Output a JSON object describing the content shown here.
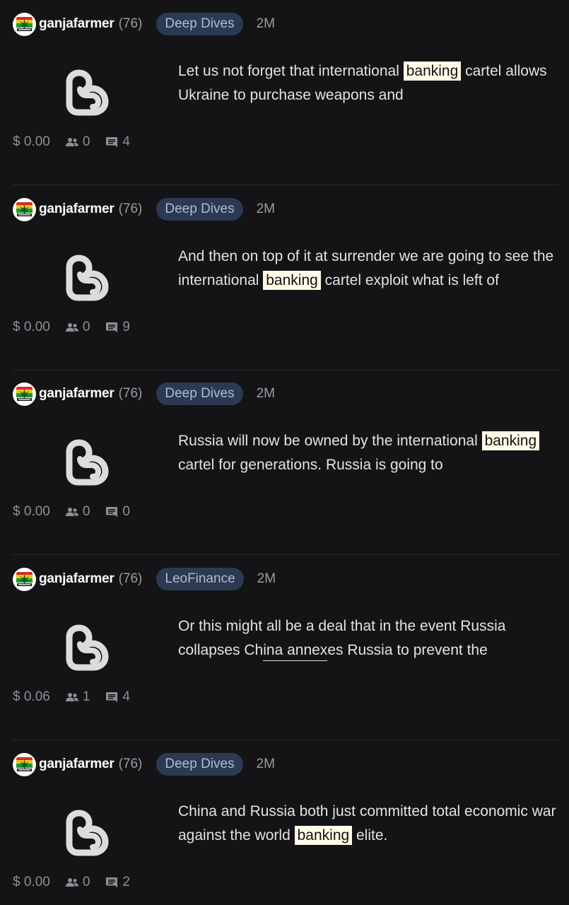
{
  "posts": [
    {
      "author": "ganjafarmer",
      "reputation": "(76)",
      "community": "Deep Dives",
      "time": "2M",
      "body_parts": [
        {
          "text": "Let us not forget that international "
        },
        {
          "text": "banking",
          "style": "hl"
        },
        {
          "text": " cartel allows Ukraine to purchase weapons and"
        }
      ],
      "payout": "$ 0.00",
      "votes": "0",
      "comments": "4"
    },
    {
      "author": "ganjafarmer",
      "reputation": "(76)",
      "community": "Deep Dives",
      "time": "2M",
      "body_parts": [
        {
          "text": "And then on top of it at surrender we are going to see the international "
        },
        {
          "text": "banking",
          "style": "hl"
        },
        {
          "text": " cartel exploit what is left of"
        }
      ],
      "payout": "$ 0.00",
      "votes": "0",
      "comments": "9"
    },
    {
      "author": "ganjafarmer",
      "reputation": "(76)",
      "community": "Deep Dives",
      "time": "2M",
      "body_parts": [
        {
          "text": "Russia will now be owned by the international "
        },
        {
          "text": "banking",
          "style": "hl"
        },
        {
          "text": " cartel for generations. Russia is going to"
        }
      ],
      "payout": "$ 0.00",
      "votes": "0",
      "comments": "0"
    },
    {
      "author": "ganjafarmer",
      "reputation": "(76)",
      "community": "LeoFinance",
      "time": "2M",
      "body_parts": [
        {
          "text": "Or this might all be a deal that in the event Russia collapses Ch"
        },
        {
          "text": "ina annex",
          "style": "ul"
        },
        {
          "text": "es Russia to prevent the"
        }
      ],
      "payout": "$ 0.06",
      "votes": "1",
      "comments": "4"
    },
    {
      "author": "ganjafarmer",
      "reputation": "(76)",
      "community": "Deep Dives",
      "time": "2M",
      "body_parts": [
        {
          "text": "China and Russia both just committed total economic war against the world "
        },
        {
          "text": "banking",
          "style": "hl"
        },
        {
          "text": " elite."
        }
      ],
      "payout": "$ 0.00",
      "votes": "0",
      "comments": "2"
    }
  ],
  "colors": {
    "background": "#141416",
    "tag_bg": "#2b3a52",
    "tag_text": "#aebbd0",
    "highlight": "#fffbe6"
  },
  "icons": {
    "thumbnail": "hive-blog-logo-icon",
    "votes": "people-icon",
    "comments": "comment-icon"
  }
}
